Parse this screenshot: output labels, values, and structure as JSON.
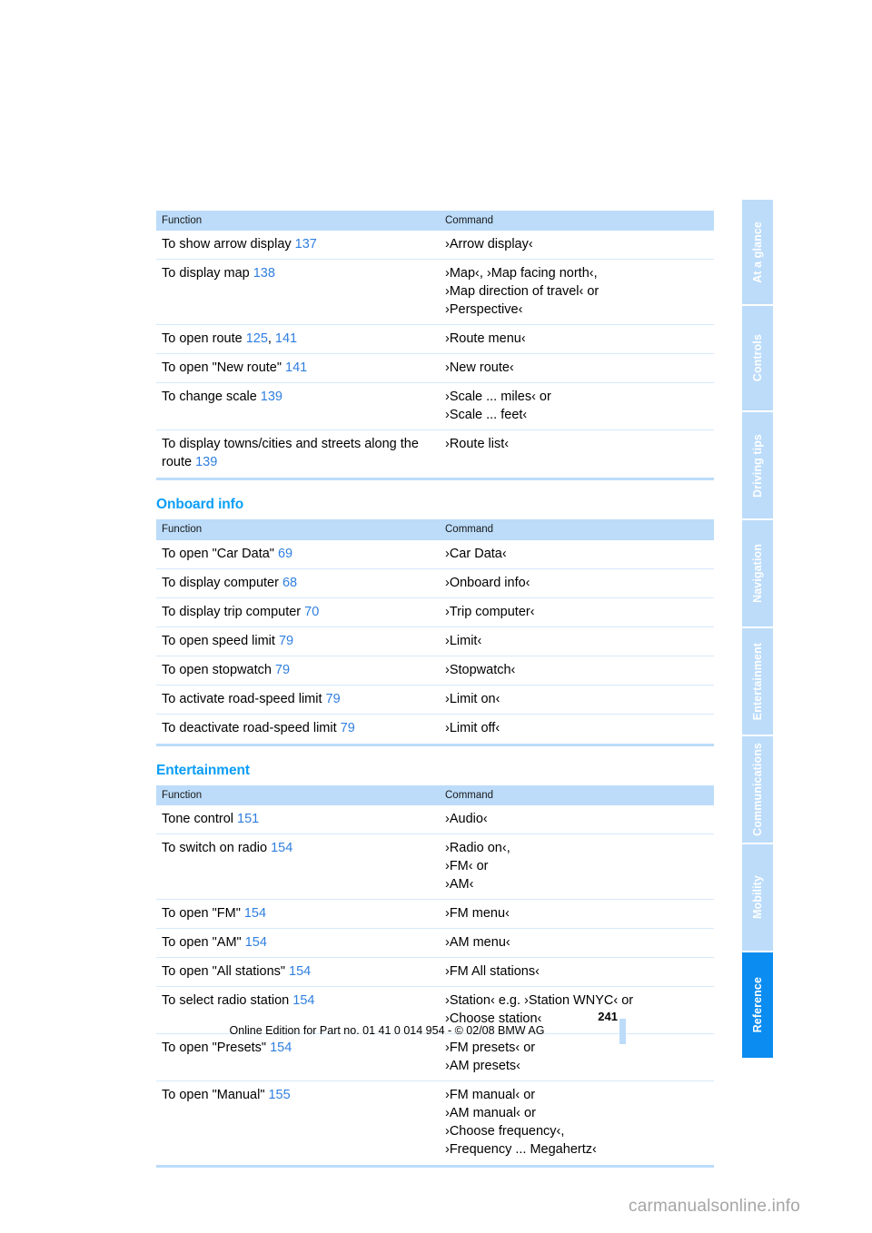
{
  "document": {
    "page_number": "241",
    "footer_line": "Online Edition for Part no. 01 41 0 014 954  - © 02/08 BMW AG",
    "watermark": "carmanualsonline.info"
  },
  "colors": {
    "header_blue": "#bcdcfa",
    "heading_blue": "#0a9ef6",
    "page_ref_blue": "#2f7fe0",
    "active_tab_blue": "#0a8cf0"
  },
  "side_rail": {
    "tabs": [
      {
        "label": "At a glance",
        "active": false
      },
      {
        "label": "Controls",
        "active": false
      },
      {
        "label": "Driving tips",
        "active": false
      },
      {
        "label": "Navigation",
        "active": false
      },
      {
        "label": "Entertainment",
        "active": false
      },
      {
        "label": "Communications",
        "active": false
      },
      {
        "label": "Mobility",
        "active": false
      },
      {
        "label": "Reference",
        "active": true
      }
    ]
  },
  "sections": [
    {
      "heading": null,
      "table": {
        "columns": [
          "Function",
          "Command"
        ],
        "rows": [
          {
            "function": "To show arrow display",
            "page_refs": [
              "137"
            ],
            "commands": [
              "›Arrow display‹"
            ]
          },
          {
            "function": "To display map",
            "page_refs": [
              "138"
            ],
            "commands": [
              "›Map‹, ›Map facing north‹,",
              "›Map direction of travel‹ or",
              "›Perspective‹"
            ]
          },
          {
            "function": "To open route",
            "page_refs": [
              "125",
              "141"
            ],
            "commands": [
              "›Route menu‹"
            ]
          },
          {
            "function": "To open \"New route\"",
            "page_refs": [
              "141"
            ],
            "commands": [
              "›New route‹"
            ]
          },
          {
            "function": "To change scale",
            "page_refs": [
              "139"
            ],
            "commands": [
              "›Scale ... miles‹ or",
              "›Scale ... feet‹"
            ]
          },
          {
            "function": "To display towns/cities and streets along the route",
            "page_refs": [
              "139"
            ],
            "commands": [
              "›Route list‹"
            ]
          }
        ]
      }
    },
    {
      "heading": "Onboard info",
      "table": {
        "columns": [
          "Function",
          "Command"
        ],
        "rows": [
          {
            "function": "To open \"Car Data\"",
            "page_refs": [
              "69"
            ],
            "commands": [
              "›Car Data‹"
            ]
          },
          {
            "function": "To display computer",
            "page_refs": [
              "68"
            ],
            "commands": [
              "›Onboard info‹"
            ]
          },
          {
            "function": "To display trip computer",
            "page_refs": [
              "70"
            ],
            "commands": [
              "›Trip computer‹"
            ]
          },
          {
            "function": "To open speed limit",
            "page_refs": [
              "79"
            ],
            "commands": [
              "›Limit‹"
            ]
          },
          {
            "function": "To open stopwatch",
            "page_refs": [
              "79"
            ],
            "commands": [
              "›Stopwatch‹"
            ]
          },
          {
            "function": "To activate road-speed limit",
            "page_refs": [
              "79"
            ],
            "commands": [
              "›Limit on‹"
            ]
          },
          {
            "function": "To deactivate road-speed limit",
            "page_refs": [
              "79"
            ],
            "commands": [
              "›Limit off‹"
            ]
          }
        ]
      }
    },
    {
      "heading": "Entertainment",
      "table": {
        "columns": [
          "Function",
          "Command"
        ],
        "rows": [
          {
            "function": "Tone control",
            "page_refs": [
              "151"
            ],
            "commands": [
              "›Audio‹"
            ]
          },
          {
            "function": "To switch on radio",
            "page_refs": [
              "154"
            ],
            "commands": [
              "›Radio on‹,",
              "›FM‹ or",
              "›AM‹"
            ]
          },
          {
            "function": "To open \"FM\"",
            "page_refs": [
              "154"
            ],
            "commands": [
              "›FM menu‹"
            ]
          },
          {
            "function": "To open \"AM\"",
            "page_refs": [
              "154"
            ],
            "commands": [
              "›AM menu‹"
            ]
          },
          {
            "function": "To open \"All stations\"",
            "page_refs": [
              "154"
            ],
            "commands": [
              "›FM All stations‹"
            ]
          },
          {
            "function": "To select radio station",
            "page_refs": [
              "154"
            ],
            "commands": [
              "›Station‹ e.g. ›Station WNYC‹ or",
              "›Choose station‹"
            ]
          },
          {
            "function": "To open \"Presets\"",
            "page_refs": [
              "154"
            ],
            "commands": [
              "›FM presets‹ or",
              "›AM presets‹"
            ]
          },
          {
            "function": "To open \"Manual\"",
            "page_refs": [
              "155"
            ],
            "commands": [
              "›FM manual‹ or",
              "›AM manual‹ or",
              "›Choose frequency‹,",
              "›Frequency ... Megahertz‹"
            ]
          }
        ]
      }
    }
  ]
}
